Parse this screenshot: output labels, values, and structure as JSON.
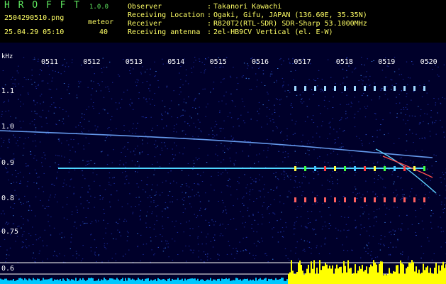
{
  "header": {
    "brand": "H R O F F T",
    "version": "1.0.0",
    "filename": "2504290510.png",
    "meteor_label": "meteor",
    "datetime": "25.04.29 05:10",
    "meteor_count": "40",
    "info": [
      {
        "label": "Observer",
        "sep": ":",
        "value": "Takanori Kawachi"
      },
      {
        "label": "Receiving Location",
        "sep": ":",
        "value": "Ogaki, Gifu, JAPAN (136.60E, 35.35N)"
      },
      {
        "label": "Receiver",
        "sep": ":",
        "value": "R820T2(RTL-SDR) SDR-Sharp 53.1000MHz"
      },
      {
        "label": "Receiving antenna",
        "sep": ":",
        "value": "2el-HB9CV Vertical (el. E-W)"
      }
    ]
  },
  "spectrogram": {
    "unit_label": "kHz",
    "time_ticks": [
      "0511",
      "0512",
      "0513",
      "0514",
      "0515",
      "0516",
      "0517",
      "0518",
      "0519",
      "0520"
    ],
    "freq_ticks": [
      "1.1",
      "1.0",
      "0.9",
      "0.8",
      "0.75",
      "0.6"
    ],
    "colors": {
      "background": "#00002a",
      "noise": "#1a2a9a",
      "carrier": "#4fd6ff",
      "level_meter": "#ffff00",
      "level_meter_low": "#00c8ff"
    }
  }
}
